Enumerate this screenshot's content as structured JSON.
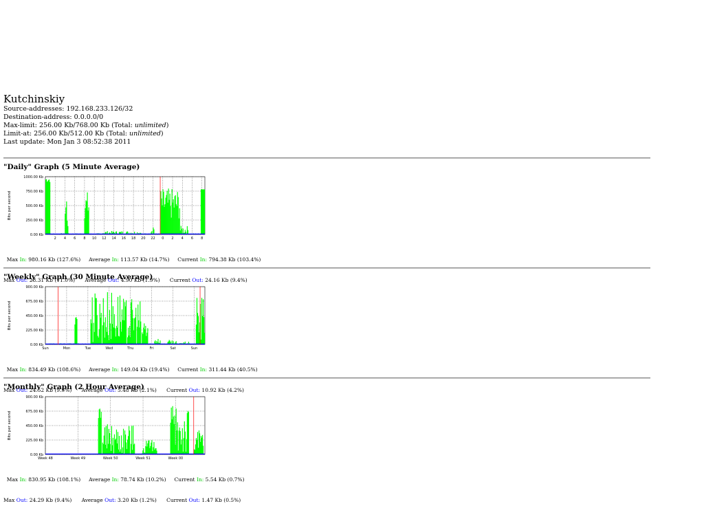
{
  "header": {
    "title": "Kutchinskiy",
    "source_label": "Source-addresses:",
    "source_value": "192.168.233.126/32",
    "dest_label": "Destination-address:",
    "dest_value": "0.0.0.0/0",
    "maxlimit_label": "Max-limit:",
    "maxlimit_value": "256.00 Kb/768.00 Kb (Total:",
    "maxlimit_total": "unlimited",
    "limitat_label": "Limit-at:",
    "limitat_value": "256.00 Kb/512.00 Kb (Total:",
    "limitat_total": "unlimited",
    "update_label": "Last update:",
    "update_value": "Mon Jan 3 08:52:38 2011"
  },
  "colors": {
    "in": "#00ff00",
    "out": "#0000ff",
    "grid": "#000000",
    "now": "#ff0000",
    "axis_label": "#000000"
  },
  "graphs": [
    {
      "title": "\"Daily\" Graph (5 Minute Average)",
      "ylabel": "Bits per second",
      "yticks": [
        "1000.00 Kb",
        "750.00 Kb",
        "500.00 Kb",
        "250.00 Kb",
        "0.00 Kb"
      ],
      "ymax": 1000,
      "xticks": [
        "2",
        "4",
        "6",
        "8",
        "10",
        "12",
        "14",
        "16",
        "18",
        "20",
        "22",
        "0",
        "2",
        "4",
        "6",
        "8"
      ],
      "max_in": "980.16 Kb (127.6%)",
      "avg_in": "113.57 Kb (14.7%)",
      "cur_in": "794.38 Kb (103.4%)",
      "max_out": "28.31 Kb (11.0%)",
      "avg_out": "4.90 Kb (1.9%)",
      "cur_out": "24.16 Kb (9.4%)"
    },
    {
      "title": "\"Weekly\" Graph (30 Minute Average)",
      "ylabel": "Bits per second",
      "yticks": [
        "900.00 Kb",
        "675.00 Kb",
        "450.00 Kb",
        "225.00 Kb",
        "0.00 Kb"
      ],
      "ymax": 900,
      "xticks": [
        "Sun",
        "Mon",
        "Tue",
        "Wed",
        "Thu",
        "Fri",
        "Sat",
        "Sun"
      ],
      "max_in": "834.49 Kb (108.6%)",
      "avg_in": "149.04 Kb (19.4%)",
      "cur_in": "311.44 Kb (40.5%)",
      "max_out": "24.52 Kb (9.5%)",
      "avg_out": "5.48 Kb (2.1%)",
      "cur_out": "10.92 Kb (4.2%)"
    },
    {
      "title": "\"Monthly\" Graph (2 Hour Average)",
      "ylabel": "Bits per second",
      "yticks": [
        "900.00 Kb",
        "675.00 Kb",
        "450.00 Kb",
        "225.00 Kb",
        "0.00 Kb"
      ],
      "ymax": 900,
      "xticks": [
        "Week 48",
        "Week 49",
        "Week 50",
        "Week 51",
        "Week 00"
      ],
      "max_in": "830.95 Kb (108.1%)",
      "avg_in": "78.74 Kb (10.2%)",
      "cur_in": "5.54 Kb (0.7%)",
      "max_out": "24.29 Kb (9.4%)",
      "avg_out": "3.20 Kb (1.2%)",
      "cur_out": "1.47 Kb (0.5%)"
    }
  ],
  "labels": {
    "max": "Max",
    "average": "Average",
    "current": "Current",
    "in": "In:",
    "out": "Out:"
  }
}
